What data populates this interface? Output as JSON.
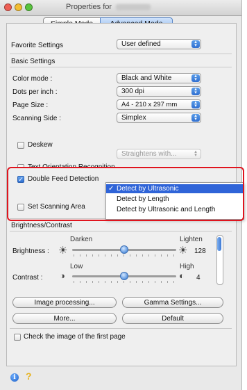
{
  "window": {
    "title_prefix": "Properties for",
    "title_redacted": "DR-C125",
    "accent_color": "#3476d8",
    "highlight_color": "#e0141e"
  },
  "modes": {
    "simple": "Simple Mode",
    "advanced": "Advanced Mode",
    "selected": "Advanced Mode"
  },
  "favorite": {
    "label": "Favorite Settings",
    "value": "User defined"
  },
  "basic": {
    "heading": "Basic Settings",
    "color_mode": {
      "label": "Color mode :",
      "value": "Black and White"
    },
    "dpi": {
      "label": "Dots per inch :",
      "value": "300 dpi"
    },
    "page_size": {
      "label": "Page Size :",
      "value": "A4 - 210 x 297 mm"
    },
    "scanning_side": {
      "label": "Scanning Side :",
      "value": "Simplex"
    },
    "deskew": {
      "label": "Deskew",
      "checked": false
    },
    "straightens": {
      "value": "Straightens with..."
    },
    "text_orientation": {
      "label": "Text Orientation Recognition",
      "checked": false
    },
    "double_feed": {
      "label": "Double Feed Detection",
      "checked": true
    },
    "scan_area": {
      "label": "Set Scanning Area",
      "checked": false
    }
  },
  "double_feed_menu": {
    "items": [
      "Detect by Ultrasonic",
      "Detect by Length",
      "Detect by Ultrasonic and Length"
    ],
    "selected_index": 0
  },
  "brightness_contrast": {
    "heading": "Brightness/Contrast",
    "brightness": {
      "label": "Brightness :",
      "min_label": "Darken",
      "max_label": "Lighten",
      "value": "128",
      "position": 0.5
    },
    "contrast": {
      "label": "Contrast :",
      "min_label": "Low",
      "max_label": "High",
      "value": "4",
      "position": 0.5
    }
  },
  "buttons": {
    "image_processing": "Image processing...",
    "gamma": "Gamma Settings...",
    "more": "More...",
    "default": "Default"
  },
  "check_first_page": {
    "label": "Check the image of the first page",
    "checked": false
  },
  "footer": {
    "info_icon": "info-icon",
    "help_icon": "help-icon"
  }
}
